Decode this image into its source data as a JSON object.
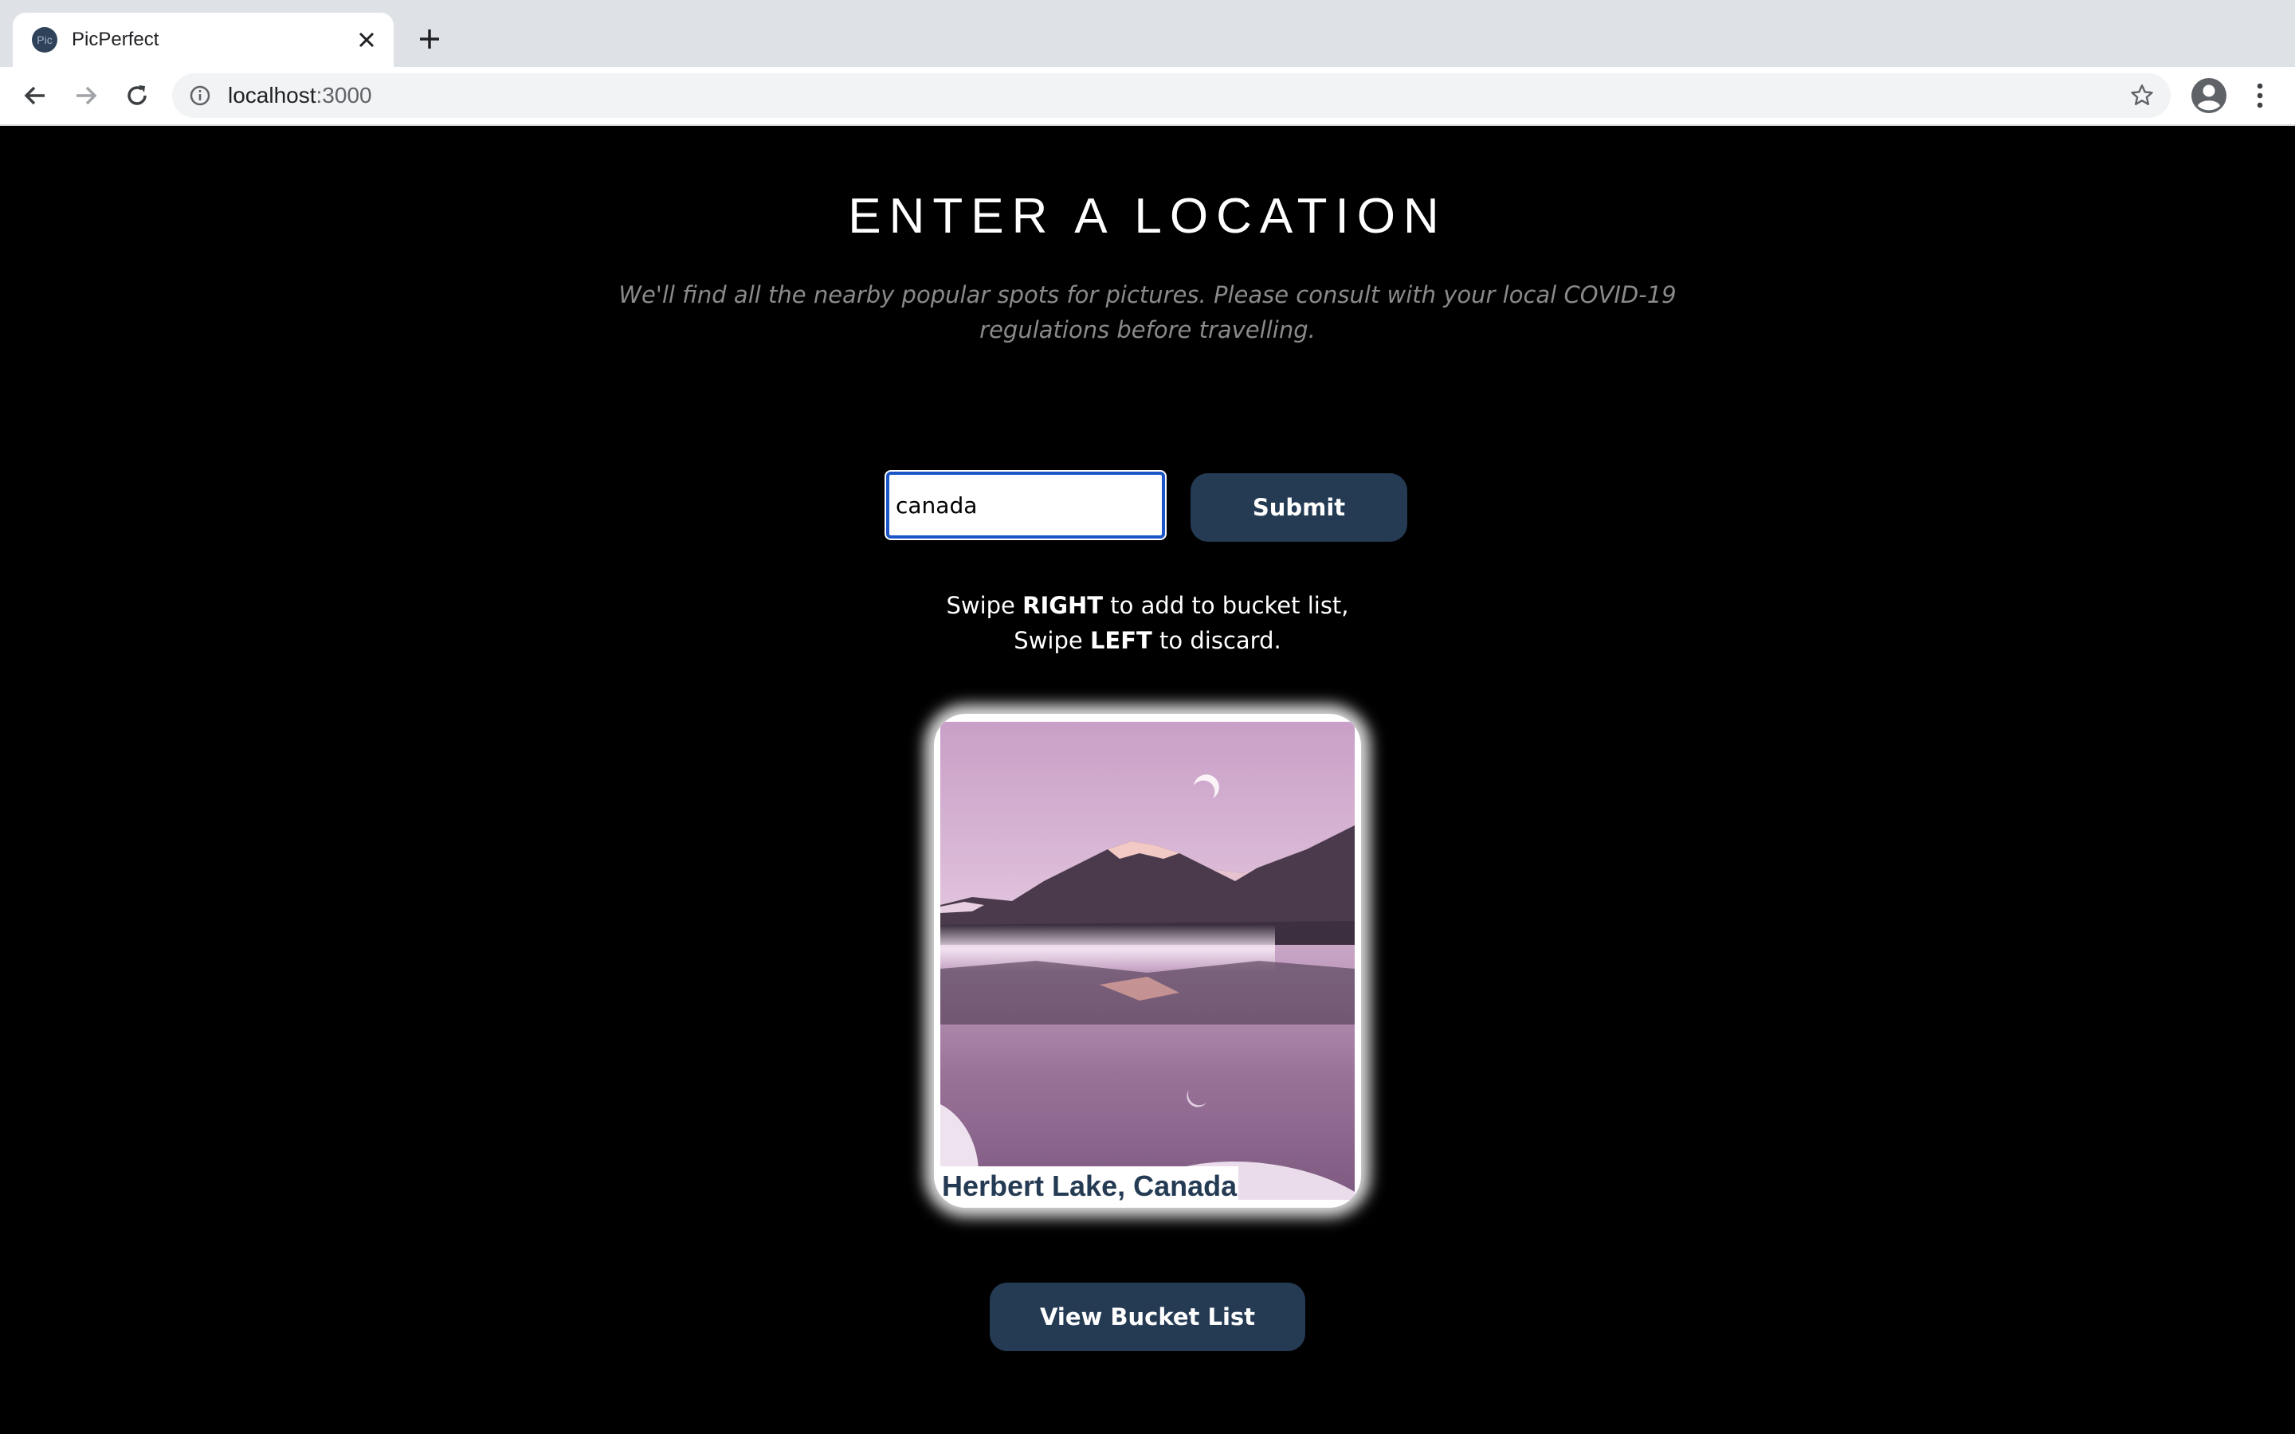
{
  "browser": {
    "tab_title": "PicPerfect",
    "favicon_text": "Pic",
    "url_host": "localhost",
    "url_port": ":3000"
  },
  "page": {
    "heading": "ENTER A LOCATION",
    "subtitle": "We'll find all the nearby popular spots for pictures. Please consult with your local COVID-19 regulations before travelling.",
    "search": {
      "value": "canada"
    },
    "submit_label": "Submit",
    "instructions": {
      "line1_prefix": "Swipe ",
      "line1_bold": "RIGHT",
      "line1_suffix": " to add to bucket list,",
      "line2_prefix": "Swipe ",
      "line2_bold": "LEFT",
      "line2_suffix": " to discard."
    },
    "card": {
      "caption": "Herbert Lake, Canada"
    },
    "bucket_button_label": "View Bucket List"
  },
  "colors": {
    "background": "#000000",
    "button": "#253b54",
    "input_focus": "#1a56c8"
  }
}
